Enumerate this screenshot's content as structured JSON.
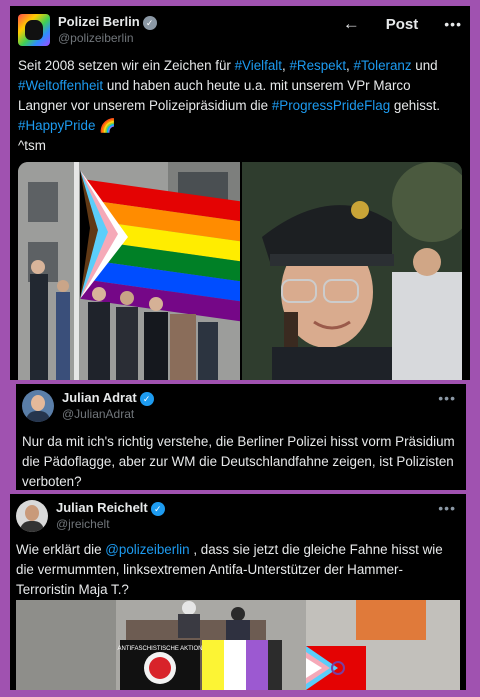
{
  "post1": {
    "author_name": "Polizei Berlin",
    "handle": "@polizeiberlin",
    "header_title": "Post",
    "back_icon": "arrow-left-icon",
    "more_icon": "more-dots-icon",
    "text_line1": "Seit 2008 setzen wir ein Zeichen für ",
    "tag_vielfalt": "#Vielfalt",
    "comma1": ", ",
    "tag_respekt": "#Respekt",
    "comma2": ", ",
    "tag_toleranz": "#Toleranz",
    "und": " und",
    "tag_weltoffenheit": "#Weltoffenheit",
    "text_line2b": " und haben auch heute u.a. mit unserem VPr Marco Langner vor unserem Polizeipräsidium die ",
    "tag_progress": "#ProgressPrideFlag",
    "gehisst": " gehisst.",
    "tag_happypride": "#HappyPride",
    "rainbow_emoji": "🌈",
    "signature": "^tsm",
    "colors": {
      "link": "#1d9bf0",
      "verified": "#8b98a5"
    }
  },
  "post2": {
    "author_name": "Julian Adrat",
    "handle": "@JulianAdrat",
    "text": "Nur da mit ich's richtig verstehe, die Berliner Polizei hisst vorm Präsidium die Pädoflagge, aber zur WM die Deutschlandfahne zeigen, ist Polizisten verboten?",
    "colors": {
      "verified": "#1d9bf0"
    }
  },
  "post3": {
    "author_name": "Julian Reichelt",
    "handle": "@jreichelt",
    "text_pre": "Wie erklärt die ",
    "mention": "@polizeiberlin",
    "text_post": " , dass sie jetzt die gleiche Fahne hisst wie die vermummten, linksextremen Antifa-Unterstützer der Hammer-Terroristin Maja T.?",
    "banner_text": "ANTIFASCHISTISCHE AKTION",
    "colors": {
      "link": "#1d9bf0",
      "verified": "#1d9bf0"
    }
  },
  "background_color": "#a052b0"
}
